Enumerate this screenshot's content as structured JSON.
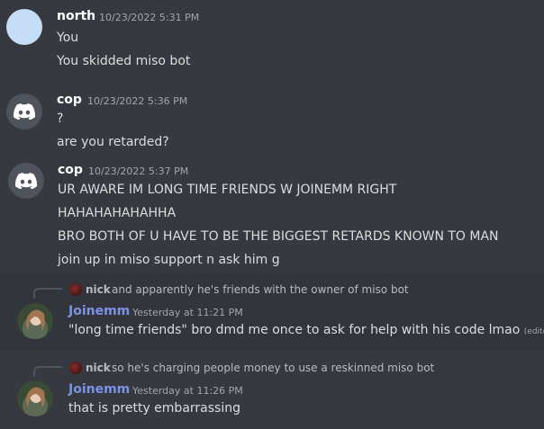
{
  "messages": [
    {
      "user": "north",
      "time": "10/23/2022 5:31 PM",
      "lines": [
        "You",
        "You skidded miso bot"
      ]
    },
    {
      "user": "cop",
      "time": "10/23/2022 5:36 PM",
      "lines": [
        "?",
        "are you retarded?"
      ]
    },
    {
      "user": "cop",
      "time": "10/23/2022 5:37 PM",
      "lines": [
        "UR AWARE IM LONG TIME FRIENDS W JOINEMM RIGHT",
        "HAHAHAHAHAHHA",
        "BRO BOTH OF U HAVE TO BE THE BIGGEST RETARDS KNOWN TO MAN",
        "join up in miso support n ask him g"
      ]
    },
    {
      "reply_user": "nick",
      "reply_text": "and apparently he's friends with the owner of miso bot",
      "user": "Joinemm",
      "time": "Yesterday at 11:21 PM",
      "lines": [
        "\"long time friends\" bro dmd me once to ask for help with his code lmao"
      ],
      "edited": "(edited)"
    },
    {
      "reply_user": "nick",
      "reply_text": "so he's charging people money to use a reskinned miso bot",
      "user": "Joinemm",
      "time": "Yesterday at 11:26 PM",
      "lines": [
        "that is pretty embarrassing"
      ]
    }
  ]
}
